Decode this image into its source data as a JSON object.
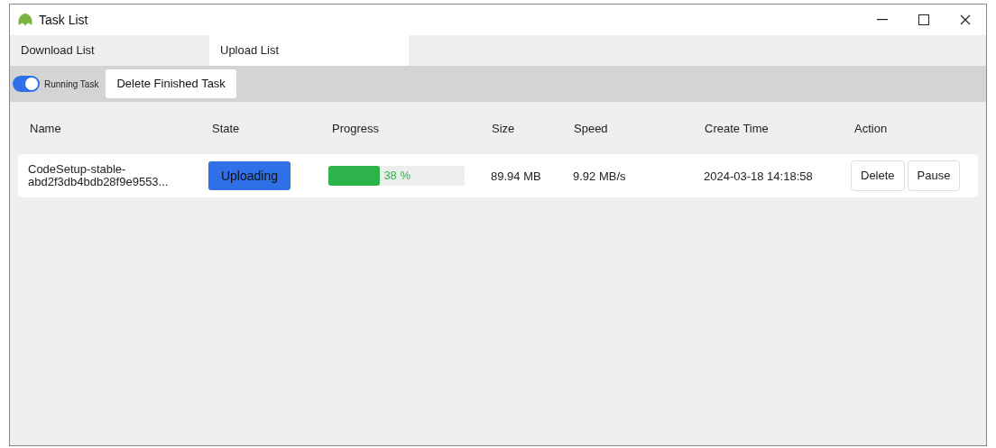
{
  "window": {
    "title": "Task List"
  },
  "tabs": [
    {
      "label": "Download List",
      "selected": false
    },
    {
      "label": "Upload List",
      "selected": true
    }
  ],
  "toolbar": {
    "toggle": {
      "label": "Running Task",
      "on": true
    },
    "button": "Delete Finished Task"
  },
  "table": {
    "columns": [
      "Name",
      "State",
      "Progress",
      "Size",
      "Speed",
      "Create Time",
      "Action"
    ],
    "rows": [
      {
        "name": "CodeSetup-stable-\nabd2f3db4bdb28f9e9553...",
        "state": "Uploading",
        "level": 0.38,
        "progress": "38 %",
        "size": "89.94 MB",
        "speed": "9.92 MB/s",
        "create_time": "2024-03-18 14:18:58",
        "actions": [
          "Delete",
          "Pause"
        ]
      }
    ]
  }
}
